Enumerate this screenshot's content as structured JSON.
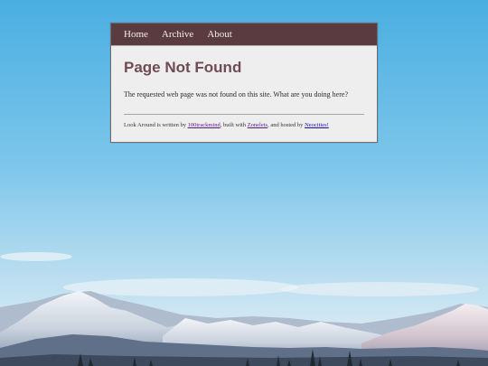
{
  "nav": {
    "items": [
      {
        "label": "Home"
      },
      {
        "label": "Archive"
      },
      {
        "label": "About"
      }
    ]
  },
  "page": {
    "title": "Page Not Found",
    "message": "The requested web page was not found on this site. What are you doing here?"
  },
  "footer": {
    "prefix": "Look Around is written by ",
    "author_link": "100trackmind",
    "middle": ", built with ",
    "builder_link": "Zonelets",
    "host_text": ", and hosted by ",
    "host_link": "Neocities!"
  },
  "colors": {
    "nav_background": "#5a3b40",
    "title": "#6e4c53",
    "card_background": "#efeeee",
    "sky_top": "#4fb0e2",
    "link": "#1a0dab"
  }
}
